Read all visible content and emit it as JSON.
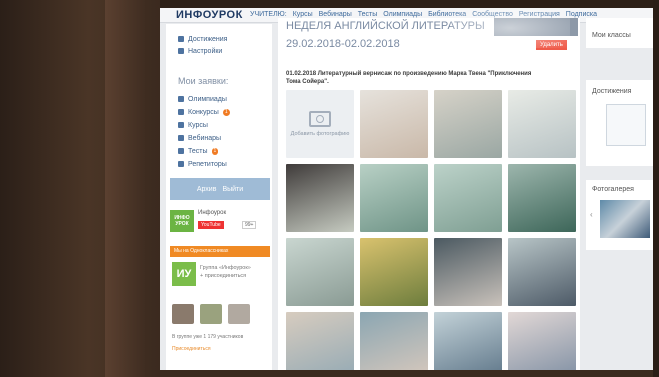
{
  "browser_header": {
    "logo": "ИНФОУРОК",
    "nav_items": [
      "УЧИТЕЛЮ:",
      "Курсы",
      "Вебинары",
      "Тесты",
      "Олимпиады",
      "Библиотека",
      "Сообщество",
      "Регистрация",
      "Подписка"
    ]
  },
  "sidebar": {
    "top_items": [
      {
        "label": "Достижения",
        "icon": "trophy-icon"
      },
      {
        "label": "Настройки",
        "icon": "gear-icon"
      }
    ],
    "section_title": "Мои заявки:",
    "items": [
      {
        "label": "Олимпиады",
        "icon": "trophy-icon",
        "badge": ""
      },
      {
        "label": "Конкурсы",
        "icon": "chart-icon",
        "badge": "1"
      },
      {
        "label": "Курсы",
        "icon": "graduation-icon",
        "badge": ""
      },
      {
        "label": "Вебинары",
        "icon": "video-icon",
        "badge": ""
      },
      {
        "label": "Тесты",
        "icon": "check-icon",
        "badge": "1"
      },
      {
        "label": "Репетиторы",
        "icon": "tutor-icon",
        "badge": ""
      }
    ],
    "action_button": {
      "left": "Архив",
      "right": "Выйти"
    },
    "infourok_channel": {
      "name": "Инфоурок",
      "youtube": "YouTube",
      "count": "99+"
    },
    "ok_bar": "Мы на Одноклассниках",
    "group": {
      "logo": "ИУ",
      "line1": "Группа «Инфоурок»",
      "line2": "+ присоединиться"
    },
    "members": "В группе уже 1 179 участников",
    "join": "Присоединиться"
  },
  "main": {
    "title": "НЕДЕЛЯ АНГЛИЙСКОЙ ЛИТЕРАТУРЫ",
    "dates": "29.02.2018-02.02.2018",
    "delete_button": "Удалить",
    "description": "01.02.2018 Литературный вернисаж по произведению Марка Твена \"Приключения Тома Сойера\".",
    "add_photo_label": "Добавить фотографию",
    "photos": [
      {
        "colors": [
          "#e6e2dc",
          "#c9b8a8"
        ]
      },
      {
        "colors": [
          "#d6d2c8",
          "#9aa7a3"
        ]
      },
      {
        "colors": [
          "#e8ebe6",
          "#b7c2c4"
        ]
      },
      {
        "colors": [
          "#3f3b3a",
          "#c6cbc1"
        ]
      },
      {
        "colors": [
          "#b8d0c5",
          "#6f9487"
        ]
      },
      {
        "colors": [
          "#bcd2c9",
          "#7f9f93"
        ]
      },
      {
        "colors": [
          "#9db6ad",
          "#3d6659"
        ]
      },
      {
        "colors": [
          "#c9d6d0",
          "#8a9b94"
        ]
      },
      {
        "colors": [
          "#d9c26e",
          "#6d7d3d"
        ]
      },
      {
        "colors": [
          "#4b5961",
          "#c9c2bb"
        ]
      },
      {
        "colors": [
          "#b8c5c7",
          "#4d5a67"
        ]
      },
      {
        "colors": [
          "#d7ccbf",
          "#93a9b4"
        ]
      },
      {
        "colors": [
          "#8ba6b2",
          "#d8c9bd"
        ]
      },
      {
        "colors": [
          "#c3d2d8",
          "#5d7588"
        ]
      },
      {
        "colors": [
          "#e2d8d6",
          "#7f8fa3"
        ]
      },
      {
        "colors": [
          "#7f92a5",
          "#d7dbd8"
        ]
      }
    ]
  },
  "right_column": {
    "my_classes": "Мои классы",
    "achievements": "Достижения",
    "gallery": "Фотогалерея"
  }
}
